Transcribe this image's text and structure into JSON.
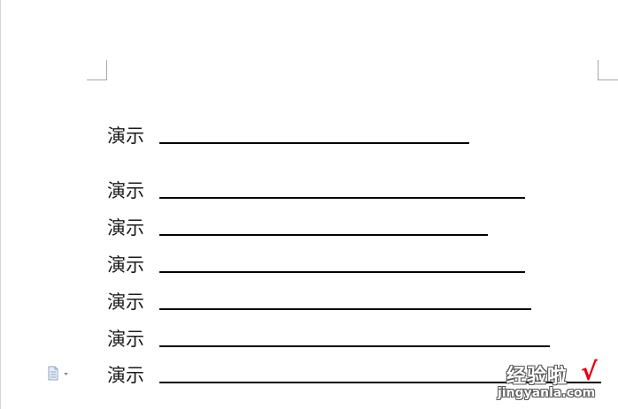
{
  "document": {
    "lines": [
      {
        "label": "演示"
      },
      {
        "label": "演示"
      },
      {
        "label": "演示"
      },
      {
        "label": "演示"
      },
      {
        "label": "演示"
      },
      {
        "label": "演示"
      },
      {
        "label": "演示"
      }
    ]
  },
  "paste_options": {
    "icon": "paste-options-icon"
  },
  "watermark": {
    "brand": "经验啦",
    "check": "√",
    "domain": "jingyanla.com",
    "check_color": "#e60012"
  }
}
